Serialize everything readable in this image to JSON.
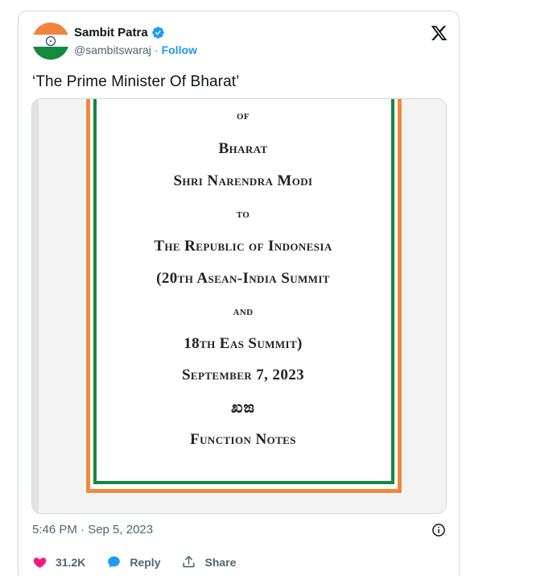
{
  "author": {
    "name": "Sambit Patra",
    "handle": "@sambitswaraj",
    "separator": "·",
    "follow_label": "Follow"
  },
  "tweet": {
    "text": "‘The Prime Minister Of Bharat’",
    "timestamp": "5:46 PM · Sep 5, 2023"
  },
  "image_doc": {
    "lines": [
      "of",
      "Bharat",
      "Shri Narendra Modi",
      "to",
      "The Republic of Indonesia",
      "(20th Asean-India Summit",
      "and",
      "18th Eas Summit)",
      "September 7, 2023",
      "ಖಙ",
      "Function Notes"
    ]
  },
  "actions": {
    "like_count": "31.2K",
    "reply_label": "Reply",
    "share_label": "Share"
  },
  "colors": {
    "accent": "#1d9bf0",
    "like": "#f91880",
    "saffron": "#f08a3c",
    "green": "#138a3f"
  },
  "icons": [
    "verified-badge-icon",
    "x-logo-icon",
    "info-icon",
    "heart-icon",
    "reply-bubble-icon",
    "share-icon"
  ]
}
